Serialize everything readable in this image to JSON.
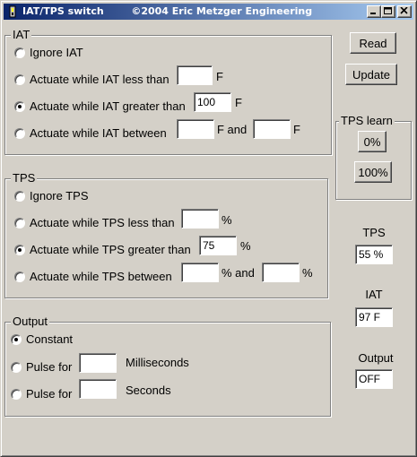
{
  "window": {
    "title": "IAT/TPS switch        ©2004 Eric Metzger Engineering"
  },
  "iat": {
    "legend": "IAT",
    "options": [
      {
        "label": "Ignore IAT",
        "checked": false
      },
      {
        "label": "Actuate while IAT less than",
        "checked": false,
        "value": "",
        "unit": "F"
      },
      {
        "label": "Actuate while IAT greater than",
        "checked": true,
        "value": "100",
        "unit": "F"
      },
      {
        "label": "Actuate while IAT between",
        "checked": false,
        "value": "",
        "unit": "F and",
        "value2": "",
        "unit2": "F"
      }
    ]
  },
  "tps": {
    "legend": "TPS",
    "options": [
      {
        "label": "Ignore TPS",
        "checked": false
      },
      {
        "label": "Actuate while TPS less than",
        "checked": false,
        "value": "",
        "unit": "%"
      },
      {
        "label": "Actuate while TPS greater than",
        "checked": true,
        "value": "75",
        "unit": "%"
      },
      {
        "label": "Actuate while TPS between",
        "checked": false,
        "value": "",
        "unit": "% and",
        "value2": "",
        "unit2": "%"
      }
    ]
  },
  "output": {
    "legend": "Output",
    "options": [
      {
        "label": "Constant",
        "checked": true
      },
      {
        "label": "Pulse for",
        "checked": false,
        "value": "",
        "unit": "Milliseconds"
      },
      {
        "label": "Pulse for",
        "checked": false,
        "value": "",
        "unit": "Seconds"
      }
    ]
  },
  "buttons": {
    "read": "Read",
    "update": "Update"
  },
  "tps_learn": {
    "legend": "TPS learn",
    "zero": "0%",
    "hundred": "100%"
  },
  "readouts": {
    "tps_label": "TPS",
    "tps_value": "55 %",
    "iat_label": "IAT",
    "iat_value": "97 F",
    "output_label": "Output",
    "output_value": "OFF"
  },
  "colors": {
    "titlebar_start": "#0a246a",
    "titlebar_end": "#a6caf0",
    "face": "#d4d0c8"
  }
}
